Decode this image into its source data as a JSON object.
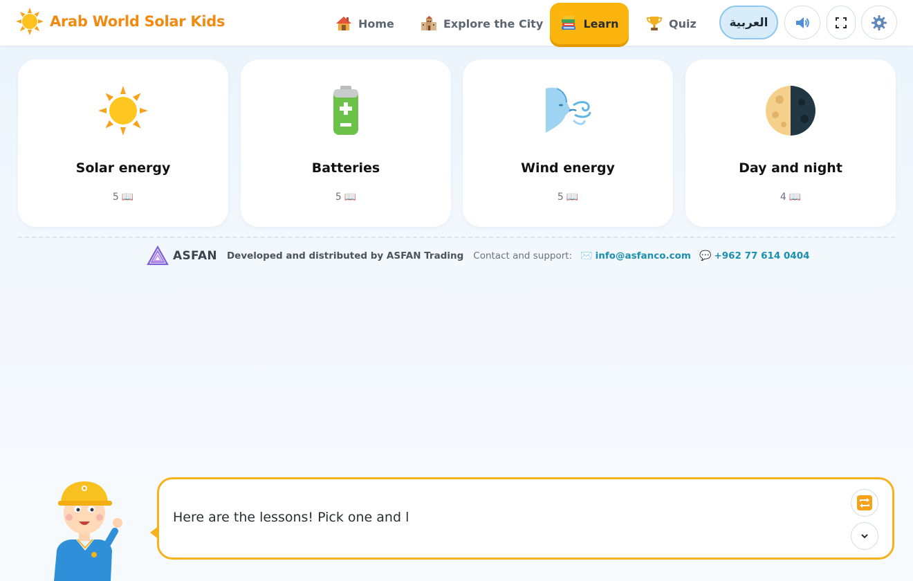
{
  "header": {
    "app_title": "Arab World Solar Kids",
    "nav": [
      {
        "label": "Home",
        "icon": "house-icon"
      },
      {
        "label": "Explore the City",
        "icon": "city-buildings-icon"
      },
      {
        "label": "Learn",
        "icon": "books-icon",
        "active": true
      },
      {
        "label": "Quiz",
        "icon": "trophy-icon"
      }
    ],
    "language_button": "العربية",
    "sound_icon": "speaker-icon",
    "fullscreen_icon": "fullscreen-icon",
    "settings_icon": "gear-icon"
  },
  "lessons": [
    {
      "title": "Solar energy",
      "count": "5",
      "icon": "sun-icon"
    },
    {
      "title": "Batteries",
      "count": "5",
      "icon": "battery-icon"
    },
    {
      "title": "Wind energy",
      "count": "5",
      "icon": "wind-face-icon"
    },
    {
      "title": "Day and night",
      "count": "4",
      "icon": "half-moon-icon"
    }
  ],
  "footer": {
    "brand": "ASFAN",
    "developed_by": "Developed and distributed by ASFAN Trading",
    "contact_label": "Contact and support:",
    "email": "info@asfanco.com",
    "phone": "+962 77 614 0404"
  },
  "speech": {
    "text": "Here are the lessons! Pick one and l",
    "replay_icon": "repeat-icon",
    "collapse_icon": "chevron-down-icon"
  },
  "colors": {
    "brand_orange": "#f08a12",
    "active_tab": "#fcb40e",
    "speech_border": "#f6b21a",
    "link_teal": "#1a8fb0",
    "language_bg": "#d8ecfa"
  }
}
